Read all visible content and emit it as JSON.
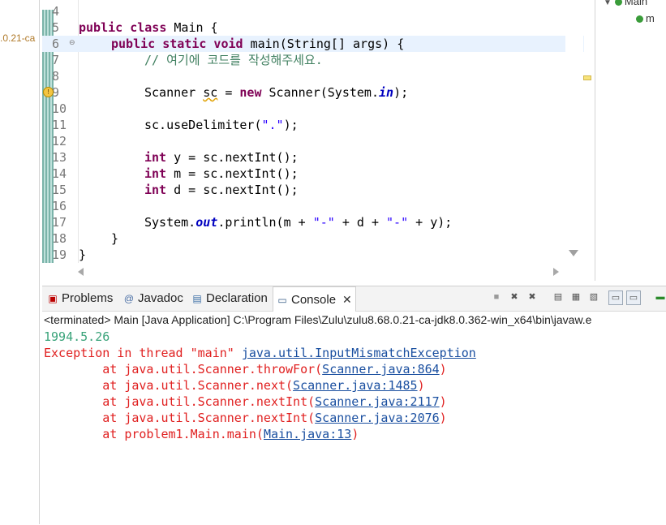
{
  "left_strip": {
    "project_label": ".0.21-ca"
  },
  "editor": {
    "lines": [
      {
        "no": "4"
      },
      {
        "no": "5"
      },
      {
        "no": "6"
      },
      {
        "no": "7"
      },
      {
        "no": "8"
      },
      {
        "no": "9"
      },
      {
        "no": "10"
      },
      {
        "no": "11"
      },
      {
        "no": "12"
      },
      {
        "no": "13"
      },
      {
        "no": "14"
      },
      {
        "no": "15"
      },
      {
        "no": "16"
      },
      {
        "no": "17"
      },
      {
        "no": "18"
      },
      {
        "no": "19"
      }
    ],
    "code": {
      "l5_kw": "public class",
      "l5_rest": " Main {",
      "l6_kw": "public static void",
      "l6_rest": " main(String[] args) {",
      "l7_comment": "// 여기에 코드를 작성해주세요.",
      "l9_a": "Scanner ",
      "l9_sc": "sc",
      "l9_b": " = ",
      "l9_new": "new",
      "l9_c": " Scanner(System.",
      "l9_in": "in",
      "l9_d": ");",
      "l11_a": "sc.useDelimiter(",
      "l11_str": "\".\"",
      "l11_b": ");",
      "l13_kw": "int",
      "l13_rest": " y = sc.nextInt();",
      "l14_kw": "int",
      "l14_rest": " m = sc.nextInt();",
      "l15_kw": "int",
      "l15_rest": " d = sc.nextInt();",
      "l17_a": "System.",
      "l17_out": "out",
      "l17_b": ".println(m + ",
      "l17_s1": "\"-\"",
      "l17_c": " + d + ",
      "l17_s2": "\"-\"",
      "l17_d": " + y);",
      "l18": "}",
      "l19": "}"
    },
    "fold_marker": "⊖",
    "warning_marker": "!"
  },
  "outline": {
    "row1": "Main",
    "row2": "m"
  },
  "console": {
    "tabs": [
      {
        "label": "Problems",
        "icon": "problems-icon"
      },
      {
        "label": "Javadoc",
        "icon": "javadoc-icon"
      },
      {
        "label": "Declaration",
        "icon": "declaration-icon"
      },
      {
        "label": "Console",
        "icon": "console-icon"
      }
    ],
    "close_glyph": "✕",
    "header": "<terminated> Main [Java Application] C:\\Program Files\\Zulu\\zulu8.68.0.21-ca-jdk8.0.362-win_x64\\bin\\javaw.e",
    "output": "1994.5.26",
    "exception_prefix": "Exception in thread \"main\" ",
    "exception_class": "java.util.InputMismatchException",
    "stack": [
      {
        "at": "        at java.util.Scanner.throwFor(",
        "link": "Scanner.java:864",
        "end": ")"
      },
      {
        "at": "        at java.util.Scanner.next(",
        "link": "Scanner.java:1485",
        "end": ")"
      },
      {
        "at": "        at java.util.Scanner.nextInt(",
        "link": "Scanner.java:2117",
        "end": ")"
      },
      {
        "at": "        at java.util.Scanner.nextInt(",
        "link": "Scanner.java:2076",
        "end": ")"
      },
      {
        "at": "        at problem1.Main.main(",
        "link": "Main.java:13",
        "end": ")"
      }
    ]
  },
  "colors": {
    "keyword": "#7f0055",
    "string": "#2a00ff",
    "comment": "#3f7f5f",
    "error": "#e02020",
    "link": "#1a4fa0",
    "stdout": "#3aa37a"
  }
}
